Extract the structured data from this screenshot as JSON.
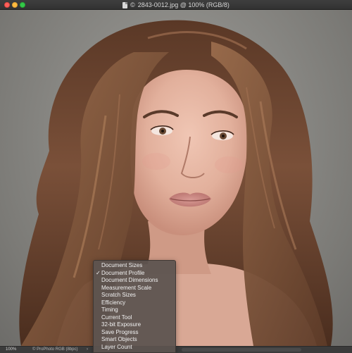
{
  "window": {
    "title": "2843-0012.jpg @ 100% (RGB/8)",
    "title_prefix": "©"
  },
  "statusbar": {
    "zoom": "100%",
    "profile": "© ProPhoto RGB (8bpc)",
    "arrow": "›"
  },
  "menu": {
    "items": [
      {
        "label": "Document Sizes",
        "checked": false
      },
      {
        "label": "Document Profile",
        "checked": true
      },
      {
        "label": "Document Dimensions",
        "checked": false
      },
      {
        "label": "Measurement Scale",
        "checked": false
      },
      {
        "label": "Scratch Sizes",
        "checked": false
      },
      {
        "label": "Efficiency",
        "checked": false
      },
      {
        "label": "Timing",
        "checked": false
      },
      {
        "label": "Current Tool",
        "checked": false
      },
      {
        "label": "32-bit Exposure",
        "checked": false
      },
      {
        "label": "Save Progress",
        "checked": false
      },
      {
        "label": "Smart Objects",
        "checked": false
      },
      {
        "label": "Layer Count",
        "checked": false
      }
    ],
    "check_glyph": "✓"
  },
  "colors": {
    "close": "#fc605b",
    "minimize": "#fdbc40",
    "maximize": "#34c84a",
    "hair": "#6b4530",
    "skin": "#e2b5a3",
    "backdrop": "#8c8b87"
  }
}
